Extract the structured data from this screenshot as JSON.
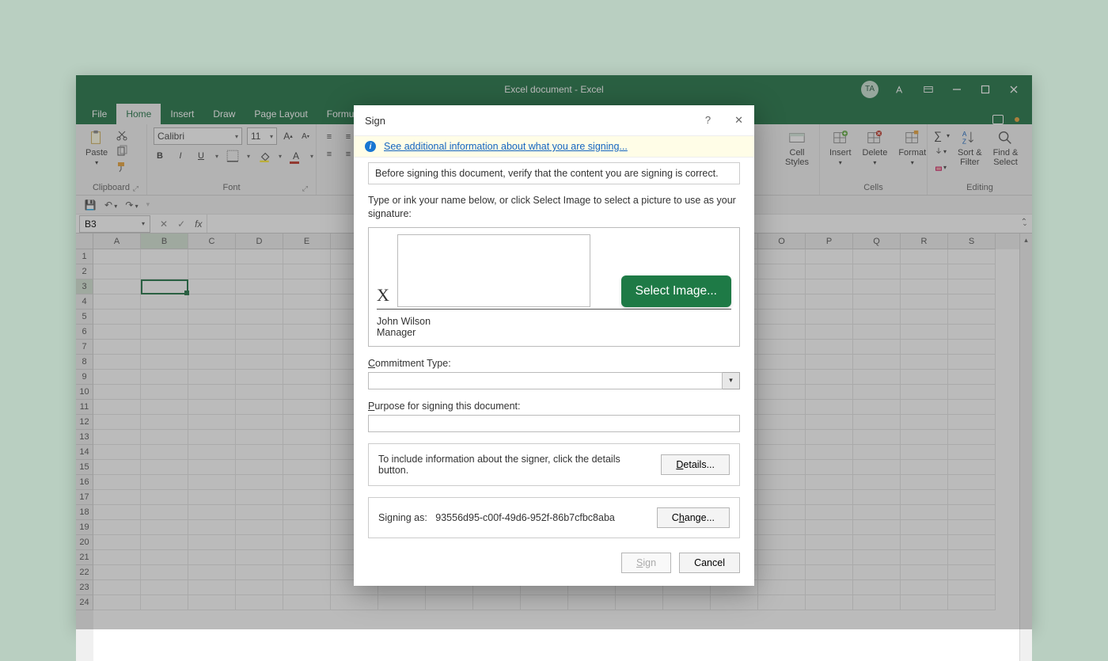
{
  "titlebar": {
    "title": "Excel document  -  Excel",
    "avatar": "TA"
  },
  "tabs": [
    "File",
    "Home",
    "Insert",
    "Draw",
    "Page Layout",
    "Formul"
  ],
  "active_tab": "Home",
  "ribbon": {
    "clipboard": {
      "paste": "Paste",
      "label": "Clipboard"
    },
    "font": {
      "name": "Calibri",
      "size": "11",
      "label": "Font"
    },
    "styles": {
      "cell_styles": "Cell\nStyles"
    },
    "cells": {
      "insert": "Insert",
      "delete": "Delete",
      "format": "Format",
      "label": "Cells"
    },
    "editing": {
      "sort": "Sort &\nFilter",
      "find": "Find &\nSelect",
      "label": "Editing"
    }
  },
  "namebox": "B3",
  "columns": [
    "A",
    "B",
    "C",
    "D",
    "E",
    "",
    "",
    "",
    "",
    "",
    "",
    "",
    "",
    "",
    "O",
    "P",
    "Q",
    "R",
    "S"
  ],
  "selected_col": "B",
  "selected_row": 3,
  "rows": 24,
  "dialog": {
    "title": "Sign",
    "banner_link": "See additional information about what you are signing...",
    "verify": "Before signing this document, verify that the content you are signing is correct.",
    "instruction": "Type or ink your name below, or click Select Image to select a picture to use as your signature:",
    "sig_x": "X",
    "select_image": "Select Image...",
    "signer_name": "John Wilson",
    "signer_title": "Manager",
    "commitment_label": "Commitment Type:",
    "purpose_label": "Purpose for signing this document:",
    "details_text": "To include information about the signer, click the details button.",
    "details_btn": "Details...",
    "signing_as_label": "Signing as:",
    "signing_as_value": "93556d95-c00f-49d6-952f-86b7cfbc8aba",
    "change_btn": "Change...",
    "sign_btn": "Sign",
    "cancel_btn": "Cancel"
  }
}
